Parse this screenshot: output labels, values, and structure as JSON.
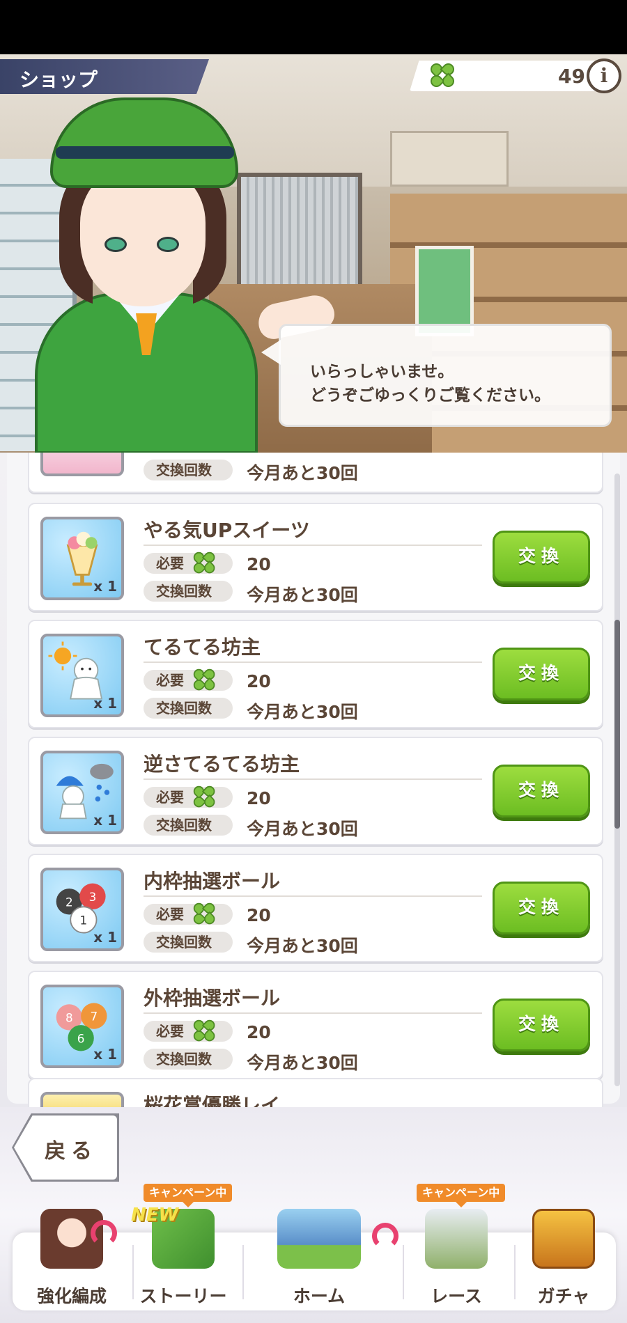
{
  "header": {
    "title": "ショップ",
    "currency_icon": "clover-icon",
    "currency_value": "49",
    "info_label": "i"
  },
  "dialogue": {
    "line1": "いらっしゃいませ。",
    "line2": "どうぞごゆっくりご覧ください。"
  },
  "shop": {
    "partial_top": {
      "count_label": "交換回数",
      "count_value": "今月あと30回"
    },
    "items": [
      {
        "name": "やる気UPスイーツ",
        "icon": "parfait-icon",
        "qty": "x 1",
        "require_label": "必要",
        "require_value": "20",
        "count_label": "交換回数",
        "count_value": "今月あと30回",
        "button": "交換"
      },
      {
        "name": "てるてる坊主",
        "icon": "teru-teru-bozu-icon",
        "qty": "x 1",
        "require_label": "必要",
        "require_value": "20",
        "count_label": "交換回数",
        "count_value": "今月あと30回",
        "button": "交換"
      },
      {
        "name": "逆さてるてる坊主",
        "icon": "upside-down-teru-teru-bozu-icon",
        "qty": "x 1",
        "require_label": "必要",
        "require_value": "20",
        "count_label": "交換回数",
        "count_value": "今月あと30回",
        "button": "交換"
      },
      {
        "name": "内枠抽選ボール",
        "icon": "inner-draw-balls-icon",
        "qty": "x 1",
        "require_label": "必要",
        "require_value": "20",
        "count_label": "交換回数",
        "count_value": "今月あと30回",
        "button": "交換"
      },
      {
        "name": "外枠抽選ボール",
        "icon": "outer-draw-balls-icon",
        "qty": "x 1",
        "require_label": "必要",
        "require_value": "20",
        "count_label": "交換回数",
        "count_value": "今月あと30回",
        "button": "交換"
      }
    ],
    "partial_bottom": {
      "name": "桜花賞優勝レイ"
    }
  },
  "back_button": "戻る",
  "nav": {
    "items": [
      {
        "label": "強化編成",
        "icon": "character-icon"
      },
      {
        "label": "ストーリー",
        "icon": "story-book-icon",
        "badge": "キャンペーン中",
        "new": "NEW"
      },
      {
        "label": "ホーム",
        "icon": "home-school-icon"
      },
      {
        "label": "レース",
        "icon": "race-gate-icon",
        "badge": "キャンペーン中"
      },
      {
        "label": "ガチャ",
        "icon": "gacha-icon"
      }
    ]
  },
  "colors": {
    "accent_green": "#6cbd22",
    "text_brown": "#5a4536",
    "header_navy": "#3a4367",
    "badge_orange": "#f08b2a"
  }
}
